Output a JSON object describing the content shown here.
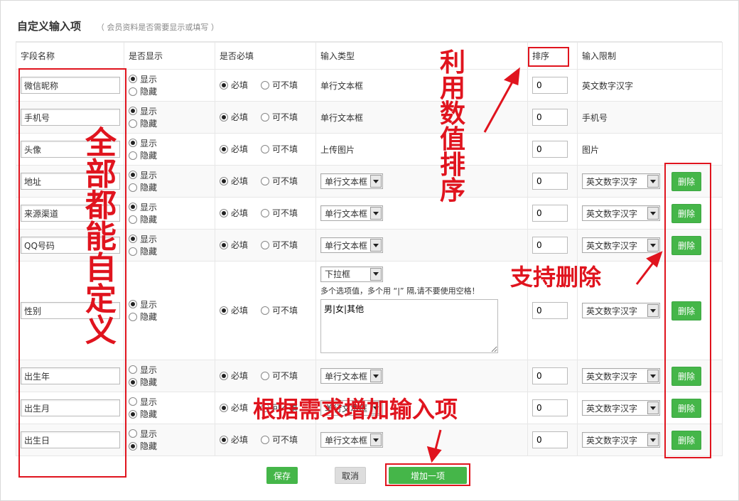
{
  "header": {
    "title": "自定义输入项",
    "subtitle": "（ 会员资料是否需要显示或填写 ）"
  },
  "columns": {
    "field_name": "字段名称",
    "show": "是否显示",
    "required": "是否必填",
    "input_type": "输入类型",
    "order": "排序",
    "limit": "输入限制"
  },
  "labels": {
    "show": "显示",
    "hide": "隐藏",
    "required": "必填",
    "optional": "可不填",
    "delete": "删除"
  },
  "rows": [
    {
      "name": "微信昵称",
      "show": true,
      "required": true,
      "type": "单行文本框",
      "type_editable": false,
      "order": "0",
      "limit": "英文数字汉字",
      "limit_editable": false,
      "deletable": false
    },
    {
      "name": "手机号",
      "show": true,
      "required": true,
      "type": "单行文本框",
      "type_editable": false,
      "order": "0",
      "limit": "手机号",
      "limit_editable": false,
      "deletable": false
    },
    {
      "name": "头像",
      "show": true,
      "required": true,
      "type": "上传图片",
      "type_editable": false,
      "order": "0",
      "limit": "图片",
      "limit_editable": false,
      "deletable": false
    },
    {
      "name": "地址",
      "show": true,
      "required": true,
      "type": "单行文本框",
      "type_editable": true,
      "order": "0",
      "limit": "英文数字汉字",
      "limit_editable": true,
      "deletable": true
    },
    {
      "name": "来源渠道",
      "show": true,
      "required": true,
      "type": "单行文本框",
      "type_editable": true,
      "order": "0",
      "limit": "英文数字汉字",
      "limit_editable": true,
      "deletable": true
    },
    {
      "name": "QQ号码",
      "show": true,
      "required": true,
      "type": "单行文本框",
      "type_editable": true,
      "order": "0",
      "limit": "英文数字汉字",
      "limit_editable": true,
      "deletable": true
    },
    {
      "name": "性别",
      "show": true,
      "required": true,
      "type": "下拉框",
      "type_editable": true,
      "order": "0",
      "limit": "英文数字汉字",
      "limit_editable": true,
      "deletable": true,
      "options_hint": "多个选项值，多个用 “|” 隔,请不要使用空格！",
      "options_value": "男|女|其他"
    },
    {
      "name": "出生年",
      "show": false,
      "required": true,
      "type": "单行文本框",
      "type_editable": true,
      "order": "0",
      "limit": "英文数字汉字",
      "limit_editable": true,
      "deletable": true
    },
    {
      "name": "出生月",
      "show": false,
      "required": true,
      "type": "单行文本框",
      "type_editable": true,
      "order": "0",
      "limit": "英文数字汉字",
      "limit_editable": true,
      "deletable": true
    },
    {
      "name": "出生日",
      "show": false,
      "required": true,
      "type": "单行文本框",
      "type_editable": true,
      "order": "0",
      "limit": "英文数字汉字",
      "limit_editable": true,
      "deletable": true
    }
  ],
  "footer": {
    "save": "保存",
    "cancel": "取消",
    "add": "增加一项"
  },
  "annotations": {
    "left": "全部都能自定义",
    "sort": "利用数值排序",
    "delete": "支持删除",
    "add": "根据需求增加输入项",
    "color": "#e0141e"
  }
}
